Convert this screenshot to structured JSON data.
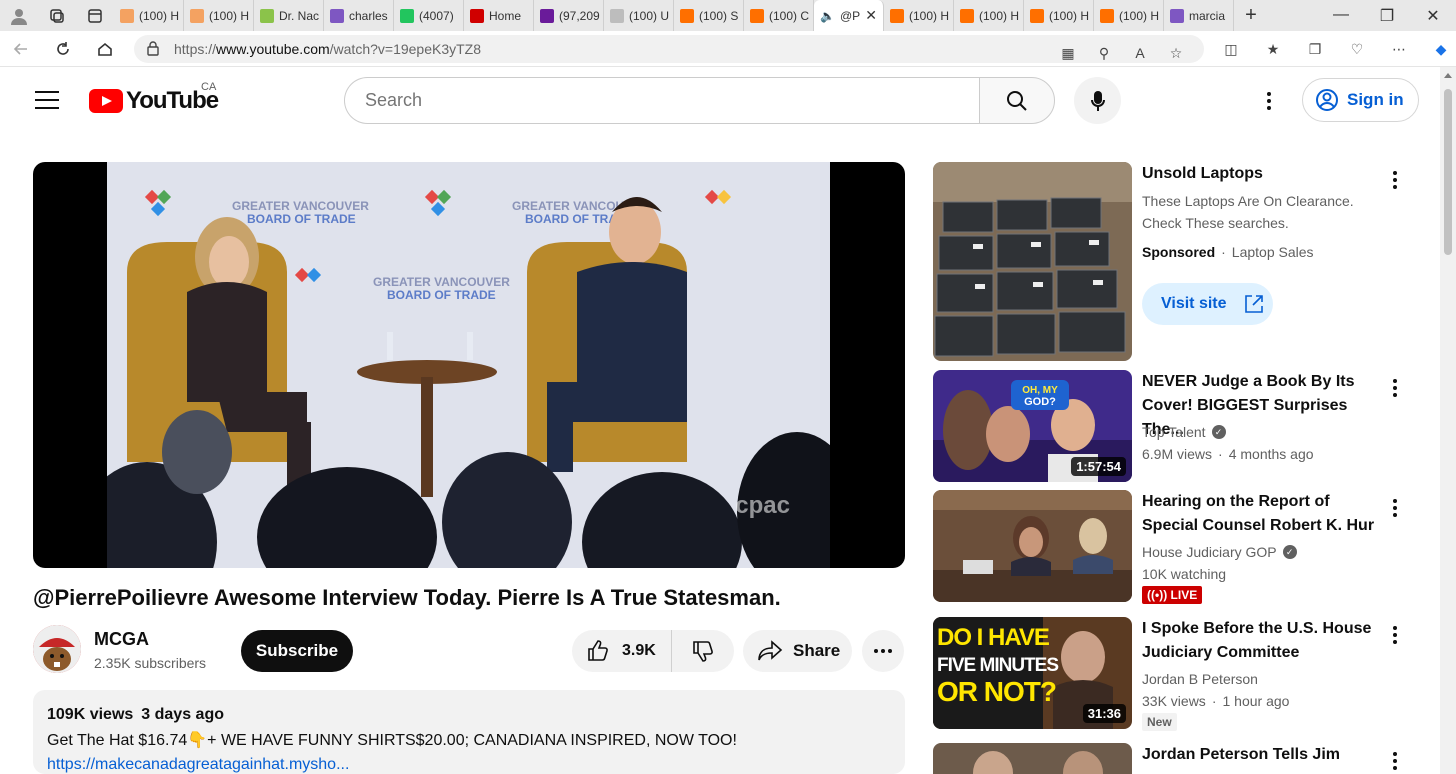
{
  "browser": {
    "tabs": [
      {
        "label": "(100) H",
        "color": "#f4a261"
      },
      {
        "label": "(100) H",
        "color": "#f4a261"
      },
      {
        "label": "Dr. Nac",
        "color": "#8bc34a"
      },
      {
        "label": "charles",
        "color": "#7e57c2"
      },
      {
        "label": "(4007)",
        "color": "#22c55e"
      },
      {
        "label": "Home",
        "color": "#d00000"
      },
      {
        "label": "(97,209",
        "color": "#6a1b9a"
      },
      {
        "label": "(100) U",
        "color": "#bdbdbd"
      },
      {
        "label": "(100) S",
        "color": "#ff6f00"
      },
      {
        "label": "(100) C",
        "color": "#ff6f00"
      },
      {
        "label": "@P",
        "color": "#ffffff",
        "active": true
      },
      {
        "label": "(100) H",
        "color": "#ff6f00"
      },
      {
        "label": "(100) H",
        "color": "#ff6f00"
      },
      {
        "label": "(100) H",
        "color": "#ff6f00"
      },
      {
        "label": "(100) H",
        "color": "#ff6f00"
      },
      {
        "label": "marcia",
        "color": "#7e57c2"
      }
    ],
    "url_proto": "https://",
    "url_host": "www.youtube.com",
    "url_path": "/watch?v=19epeK3yTZ8"
  },
  "header": {
    "logo_text": "YouTube",
    "country_code": "CA",
    "search_placeholder": "Search",
    "sign_in": "Sign in"
  },
  "player": {
    "backdrop_text": "GREATER VANCOUVER\nBOARD OF TRADE",
    "watermark": "cpac"
  },
  "video": {
    "title": "@PierrePoilievre Awesome Interview Today. Pierre Is A True Statesman.",
    "channel": "MCGA",
    "subscribers": "2.35K subscribers",
    "subscribe_label": "Subscribe",
    "likes": "3.9K",
    "share_label": "Share",
    "views": "109K views",
    "age": "3 days ago",
    "desc_line": "Get The  Hat $16.74👇+ WE HAVE FUNNY SHIRTS$20.00; CANADIANA INSPIRED, NOW TOO!",
    "desc_link": "https://makecanadagreatagainhat.mysho..."
  },
  "sidebar": {
    "ad": {
      "title": "Unsold Laptops",
      "body": "These Laptops Are On Clearance. Check These searches.",
      "sponsored": "Sponsored",
      "advertiser": "Laptop Sales",
      "cta": "Visit site"
    },
    "videos": [
      {
        "title": "NEVER Judge a Book By Its Cover! BIGGEST Surprises The...",
        "channel": "Top Talent",
        "views": "6.9M views",
        "age": "4 months ago",
        "duration": "1:57:54",
        "thumb_text": "OH, MY GOD?"
      },
      {
        "title": "Hearing on the Report of Special Counsel Robert K. Hur",
        "channel": "House Judiciary GOP",
        "views": "10K watching",
        "live": "LIVE"
      },
      {
        "title": "I Spoke Before the U.S. House Judiciary Committee",
        "channel": "Jordan B Peterson",
        "views": "33K views",
        "age": "1 hour ago",
        "duration": "31:36",
        "badge": "New",
        "thumb_text": "DO I HAVE FIVE MINUTES OR NOT?"
      },
      {
        "title": "Jordan Peterson Tells Jim"
      }
    ]
  }
}
